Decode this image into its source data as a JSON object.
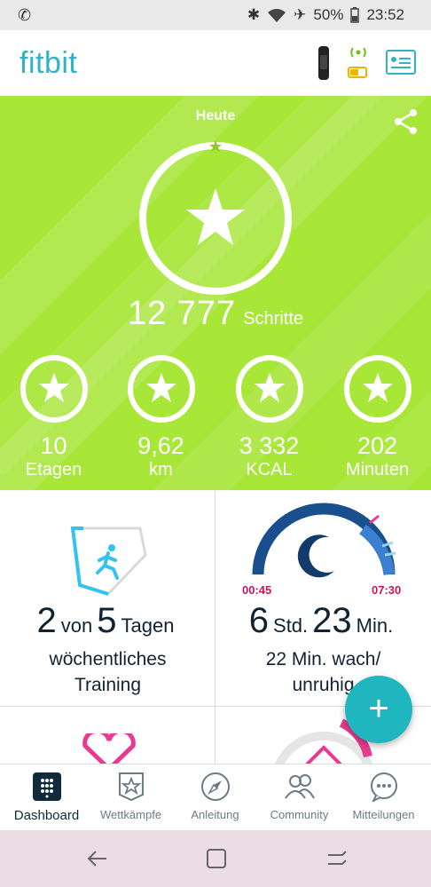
{
  "status_bar": {
    "battery": "50%",
    "time": "23:52"
  },
  "app": {
    "logo": "fitbit"
  },
  "hero": {
    "title": "Heute",
    "steps_value": "12 777",
    "steps_label": "Schritte",
    "metrics": [
      {
        "value": "10",
        "label": "Etagen"
      },
      {
        "value": "9,62",
        "label": "km"
      },
      {
        "value": "3 332",
        "label": "KCAL"
      },
      {
        "value": "202",
        "label": "Minuten"
      }
    ],
    "background": "#a8e638"
  },
  "tiles": {
    "exercise": {
      "num1": "2",
      "word1": "von",
      "num2": "5",
      "word2": "Tagen",
      "line1": "wöchentliches",
      "line2": "Training"
    },
    "sleep": {
      "start": "00:45",
      "end": "07:30",
      "hours": "6",
      "hours_unit": "Std.",
      "minutes": "23",
      "minutes_unit": "Min.",
      "line1": "22 Min. wach/",
      "line2": "unruhig"
    }
  },
  "fab": {
    "label": "+"
  },
  "tabs": [
    {
      "label": "Dashboard",
      "icon": "dashboard-icon",
      "active": true
    },
    {
      "label": "Wettkämpfe",
      "icon": "star-badge-icon"
    },
    {
      "label": "Anleitung",
      "icon": "compass-icon"
    },
    {
      "label": "Community",
      "icon": "people-icon"
    },
    {
      "label": "Mitteilungen",
      "icon": "chat-icon"
    }
  ],
  "colors": {
    "brand": "#2fb3c5",
    "fab": "#1fb6bf",
    "sleep_arc": "#1a4f8e",
    "heart": "#e83a8e"
  }
}
